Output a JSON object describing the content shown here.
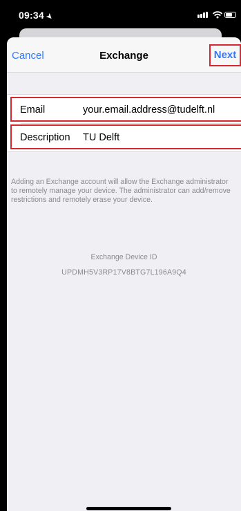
{
  "status_bar": {
    "time": "09:34",
    "location_glyph": "➤",
    "signal_bars": [
      0.35,
      0.55,
      0.75,
      1.0
    ]
  },
  "nav": {
    "cancel_label": "Cancel",
    "title": "Exchange",
    "next_label": "Next"
  },
  "form": {
    "rows": [
      {
        "label": "Email",
        "value": "your.email.address@tudelft.nl"
      },
      {
        "label": "Description",
        "value": "TU Delft"
      }
    ]
  },
  "footer": {
    "text": "Adding an Exchange account will allow the Exchange administrator to remotely manage your device. The administrator can add/remove restrictions and remotely erase your device.",
    "device_id_label": "Exchange Device ID",
    "device_id": "UPDMH5V3RP17V8BTG7L196A9Q4"
  },
  "colors": {
    "accent": "#3478f6",
    "highlight": "#d9252f",
    "secondary_text": "#8a8a8f",
    "group_background": "#efeff4"
  },
  "icons": [
    "location-arrow-icon",
    "signal-icon",
    "wifi-icon",
    "battery-icon"
  ]
}
